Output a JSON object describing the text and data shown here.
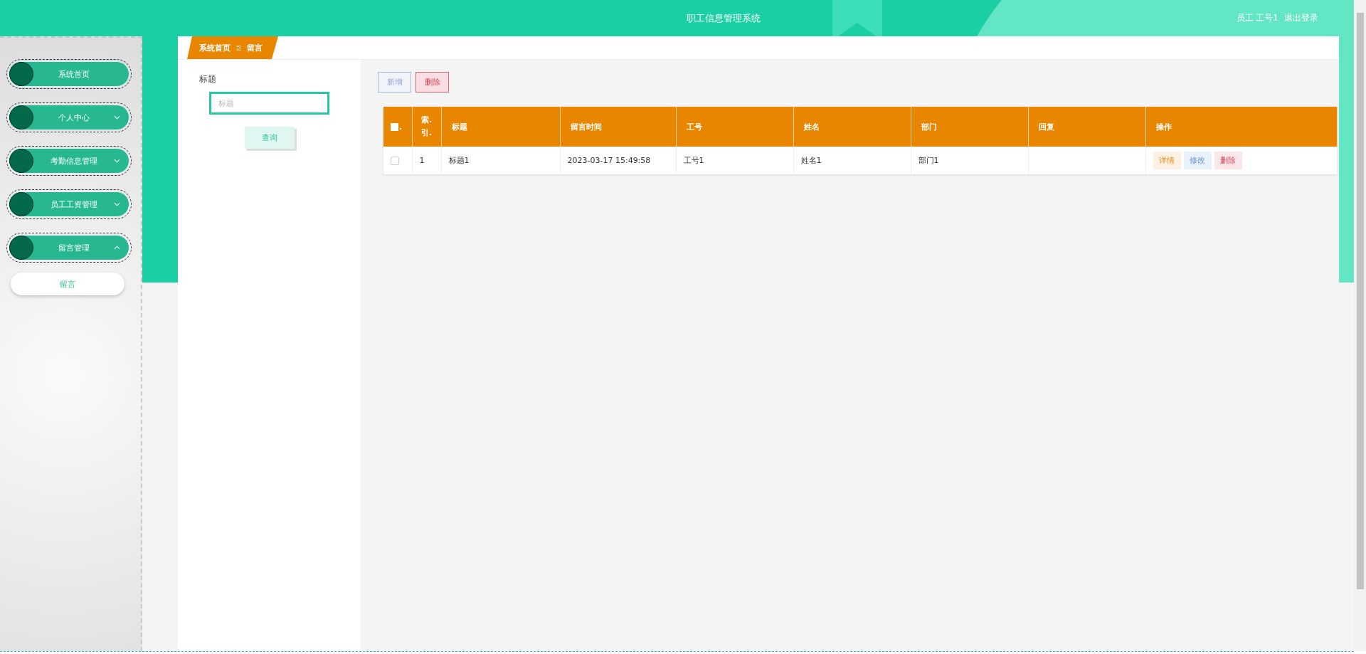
{
  "header": {
    "title": "职工信息管理系统",
    "user": "员工 工号1",
    "logout": "退出登录"
  },
  "sidebar": {
    "items": [
      {
        "label": "系统首页",
        "kind": "link"
      },
      {
        "label": "个人中心",
        "kind": "menu",
        "expanded": false
      },
      {
        "label": "考勤信息管理",
        "kind": "menu",
        "expanded": false
      },
      {
        "label": "员工工资管理",
        "kind": "menu",
        "expanded": false
      },
      {
        "label": "留言管理",
        "kind": "menu",
        "expanded": true,
        "children": [
          {
            "label": "留言",
            "selected": true
          }
        ]
      }
    ]
  },
  "breadcrumb": [
    "系统首页",
    "留言"
  ],
  "search": {
    "label": "标题",
    "placeholder": "标题",
    "button": "查询"
  },
  "actions": [
    {
      "label": "新增",
      "kind": "add"
    },
    {
      "label": "删除",
      "kind": "delete"
    }
  ],
  "table": {
    "columns": [
      {
        "label": ".",
        "kind": "checkbox",
        "checked": false
      },
      {
        "label": "索.引.",
        "kind": "index"
      },
      {
        "label": "标题",
        "kind": "text"
      },
      {
        "label": "留言时间",
        "kind": "text"
      },
      {
        "label": "工号",
        "kind": "text"
      },
      {
        "label": "姓名",
        "kind": "text"
      },
      {
        "label": "部门",
        "kind": "text"
      },
      {
        "label": "回复",
        "kind": "reply"
      },
      {
        "label": "操作",
        "kind": "actions"
      }
    ],
    "rows": [
      {
        "checked": false,
        "cells": [
          "",
          "1",
          "标题1",
          "2023-03-17 15:49:58",
          "工号1",
          "姓名1",
          "部门1",
          ""
        ],
        "actions": [
          {
            "label": "详情",
            "kind": "detail"
          },
          {
            "label": "修改",
            "kind": "edit"
          },
          {
            "label": "删除",
            "kind": "delete"
          }
        ]
      }
    ]
  }
}
